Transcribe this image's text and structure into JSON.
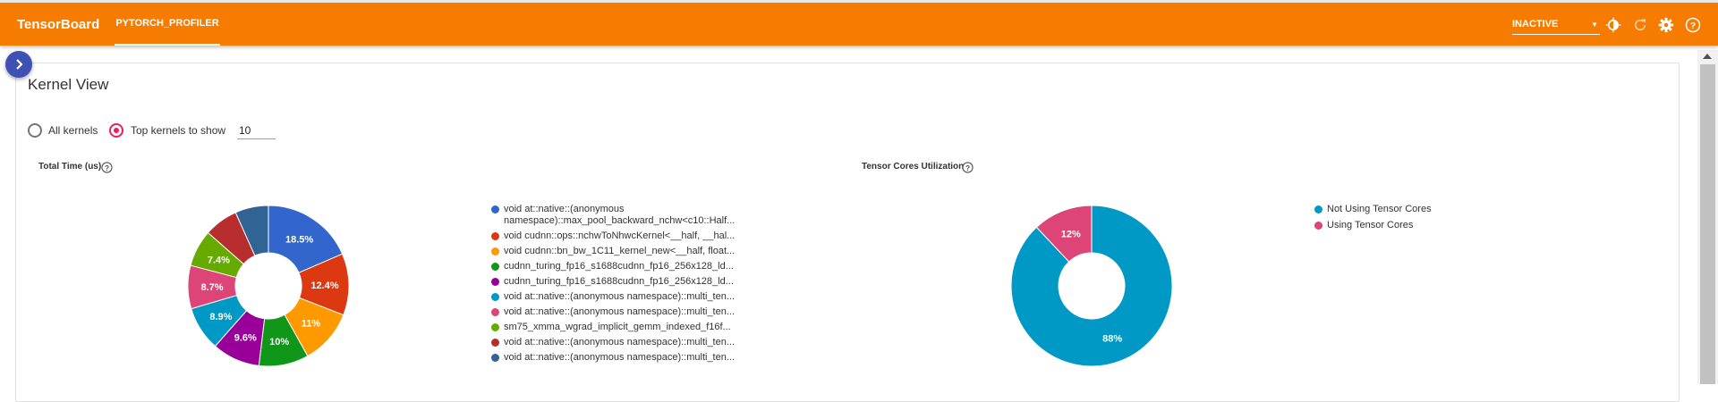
{
  "header": {
    "brand": "TensorBoard",
    "active_tab": "PYTORCH_PROFILER",
    "reload_status": "INACTIVE",
    "colors": {
      "topbar": "#f57c00",
      "accent": "#e91e63"
    }
  },
  "view": {
    "title": "Kernel View",
    "radio_all_label": "All kernels",
    "radio_top_label": "Top kernels to show",
    "top_k_value": "10"
  },
  "total_time": {
    "title": "Total Time (us)",
    "legend": [
      {
        "label": "void at::native::(anonymous",
        "label2": "namespace)::max_pool_backward_nchw<c10::Half...",
        "color": "#3366cc"
      },
      {
        "label": "void cudnn::ops::nchwToNhwcKernel<__half, __hal...",
        "color": "#dc3912"
      },
      {
        "label": "void cudnn::bn_bw_1C11_kernel_new<__half, float...",
        "color": "#ff9900"
      },
      {
        "label": "cudnn_turing_fp16_s1688cudnn_fp16_256x128_ld...",
        "color": "#109618"
      },
      {
        "label": "cudnn_turing_fp16_s1688cudnn_fp16_256x128_ld...",
        "color": "#990099"
      },
      {
        "label": "void at::native::(anonymous namespace)::multi_ten...",
        "color": "#0099c6"
      },
      {
        "label": "void at::native::(anonymous namespace)::multi_ten...",
        "color": "#dd4477"
      },
      {
        "label": "sm75_xmma_wgrad_implicit_gemm_indexed_f16f...",
        "color": "#66aa00"
      },
      {
        "label": "void at::native::(anonymous namespace)::multi_ten...",
        "color": "#b82e2e"
      },
      {
        "label": "void at::native::(anonymous namespace)::multi_ten...",
        "color": "#316395"
      }
    ]
  },
  "tensor_cores": {
    "title": "Tensor Cores Utilization",
    "legend": [
      {
        "label": "Not Using Tensor Cores",
        "color": "#0099c6"
      },
      {
        "label": "Using Tensor Cores",
        "color": "#dd4477"
      }
    ]
  },
  "chart_data": [
    {
      "type": "pie",
      "title": "Total Time (us)",
      "categories": [
        "void at::native::(anonymous namespace)::max_pool_backward_nchw<c10::Half...",
        "void cudnn::ops::nchwToNhwcKernel<__half, __hal...",
        "void cudnn::bn_bw_1C11_kernel_new<__half, float...",
        "cudnn_turing_fp16_s1688cudnn_fp16_256x128_ld...",
        "cudnn_turing_fp16_s1688cudnn_fp16_256x128_ld...",
        "void at::native::(anonymous namespace)::multi_ten...",
        "void at::native::(anonymous namespace)::multi_ten...",
        "sm75_xmma_wgrad_implicit_gemm_indexed_f16f...",
        "void at::native::(anonymous namespace)::multi_ten...",
        "void at::native::(anonymous namespace)::multi_ten..."
      ],
      "values": [
        18.5,
        12.4,
        11,
        10,
        9.6,
        8.9,
        8.7,
        7.4,
        6.8,
        6.7
      ],
      "labels": [
        "18.5%",
        "12.4%",
        "11%",
        "10%",
        "9.6%",
        "8.9%",
        "8.7%",
        "7.4%",
        "",
        ""
      ],
      "colors": [
        "#3366cc",
        "#dc3912",
        "#ff9900",
        "#109618",
        "#990099",
        "#0099c6",
        "#dd4477",
        "#66aa00",
        "#b82e2e",
        "#316395"
      ],
      "legend": "right"
    },
    {
      "type": "pie",
      "title": "Tensor Cores Utilization",
      "categories": [
        "Not Using Tensor Cores",
        "Using Tensor Cores"
      ],
      "values": [
        88,
        12
      ],
      "labels": [
        "88%",
        "12%"
      ],
      "colors": [
        "#0099c6",
        "#dd4477"
      ],
      "legend": "right"
    }
  ]
}
